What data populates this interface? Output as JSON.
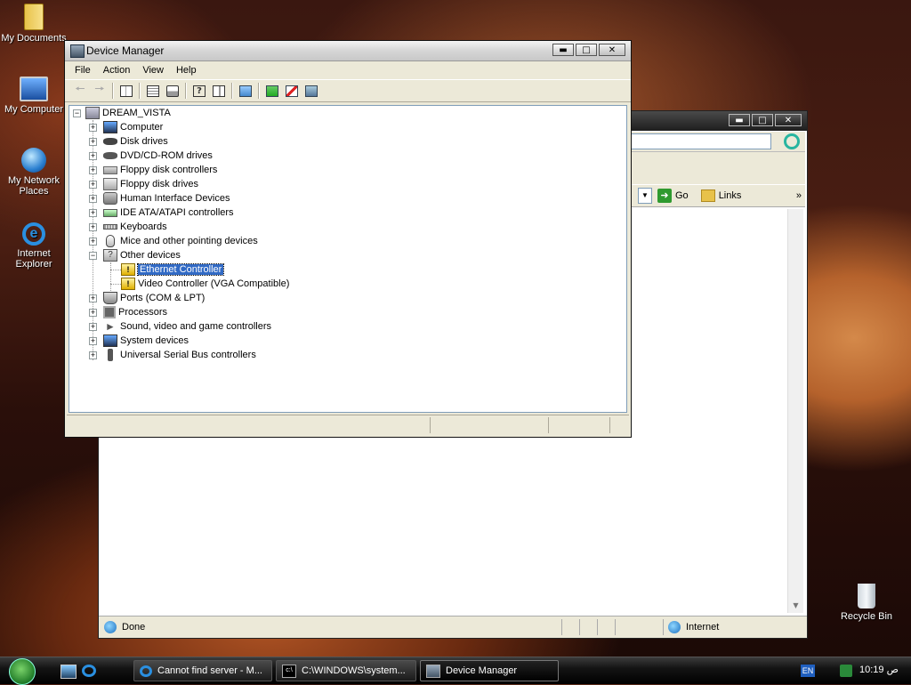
{
  "desktop": {
    "icons": [
      {
        "label": "My Documents",
        "icon": "folder-documents-icon"
      },
      {
        "label": "My Computer",
        "icon": "computer-icon"
      },
      {
        "label": "My Network Places",
        "icon": "network-globe-icon"
      },
      {
        "label": "Internet Explorer",
        "icon": "internet-explorer-icon"
      },
      {
        "label": "Recycle Bin",
        "icon": "recycle-bin-icon"
      }
    ]
  },
  "ie_window": {
    "toolbar": {
      "go_label": "Go",
      "links_label": "Links",
      "more": "»"
    },
    "status": {
      "text": "Done",
      "zone": "Internet"
    }
  },
  "device_manager": {
    "title": "Device Manager",
    "menu": [
      "File",
      "Action",
      "View",
      "Help"
    ],
    "root": "DREAM_VISTA",
    "categories": [
      {
        "label": "Computer",
        "icon": "computer-icon",
        "expanded": false
      },
      {
        "label": "Disk drives",
        "icon": "disk-drive-icon",
        "expanded": false
      },
      {
        "label": "DVD/CD-ROM drives",
        "icon": "dvd-drive-icon",
        "expanded": false
      },
      {
        "label": "Floppy disk controllers",
        "icon": "floppy-controller-icon",
        "expanded": false
      },
      {
        "label": "Floppy disk drives",
        "icon": "floppy-drive-icon",
        "expanded": false
      },
      {
        "label": "Human Interface Devices",
        "icon": "hid-icon",
        "expanded": false
      },
      {
        "label": "IDE ATA/ATAPI controllers",
        "icon": "ide-controller-icon",
        "expanded": false
      },
      {
        "label": "Keyboards",
        "icon": "keyboard-icon",
        "expanded": false
      },
      {
        "label": "Mice and other pointing devices",
        "icon": "mouse-icon",
        "expanded": false
      },
      {
        "label": "Other devices",
        "icon": "unknown-device-icon",
        "expanded": true,
        "children": [
          {
            "label": "Ethernet Controller",
            "icon": "warning-device-icon",
            "selected": true
          },
          {
            "label": "Video Controller (VGA Compatible)",
            "icon": "warning-device-icon",
            "selected": false
          }
        ]
      },
      {
        "label": "Ports (COM & LPT)",
        "icon": "port-icon",
        "expanded": false
      },
      {
        "label": "Processors",
        "icon": "processor-icon",
        "expanded": false
      },
      {
        "label": "Sound, video and game controllers",
        "icon": "sound-icon",
        "expanded": false
      },
      {
        "label": "System devices",
        "icon": "system-device-icon",
        "expanded": false
      },
      {
        "label": "Universal Serial Bus controllers",
        "icon": "usb-icon",
        "expanded": false
      }
    ]
  },
  "taskbar": {
    "tasks": [
      {
        "label": "Cannot find server - M...",
        "icon": "internet-explorer-icon",
        "active": false
      },
      {
        "label": "C:\\WINDOWS\\system...",
        "icon": "command-prompt-icon",
        "active": false
      },
      {
        "label": "Device Manager",
        "icon": "device-manager-icon",
        "active": true
      }
    ],
    "language": "EN",
    "clock": "10:19 ص"
  },
  "colors": {
    "selection": "#316ac5",
    "taskbar": "#141414",
    "window_face": "#ece9d8"
  }
}
